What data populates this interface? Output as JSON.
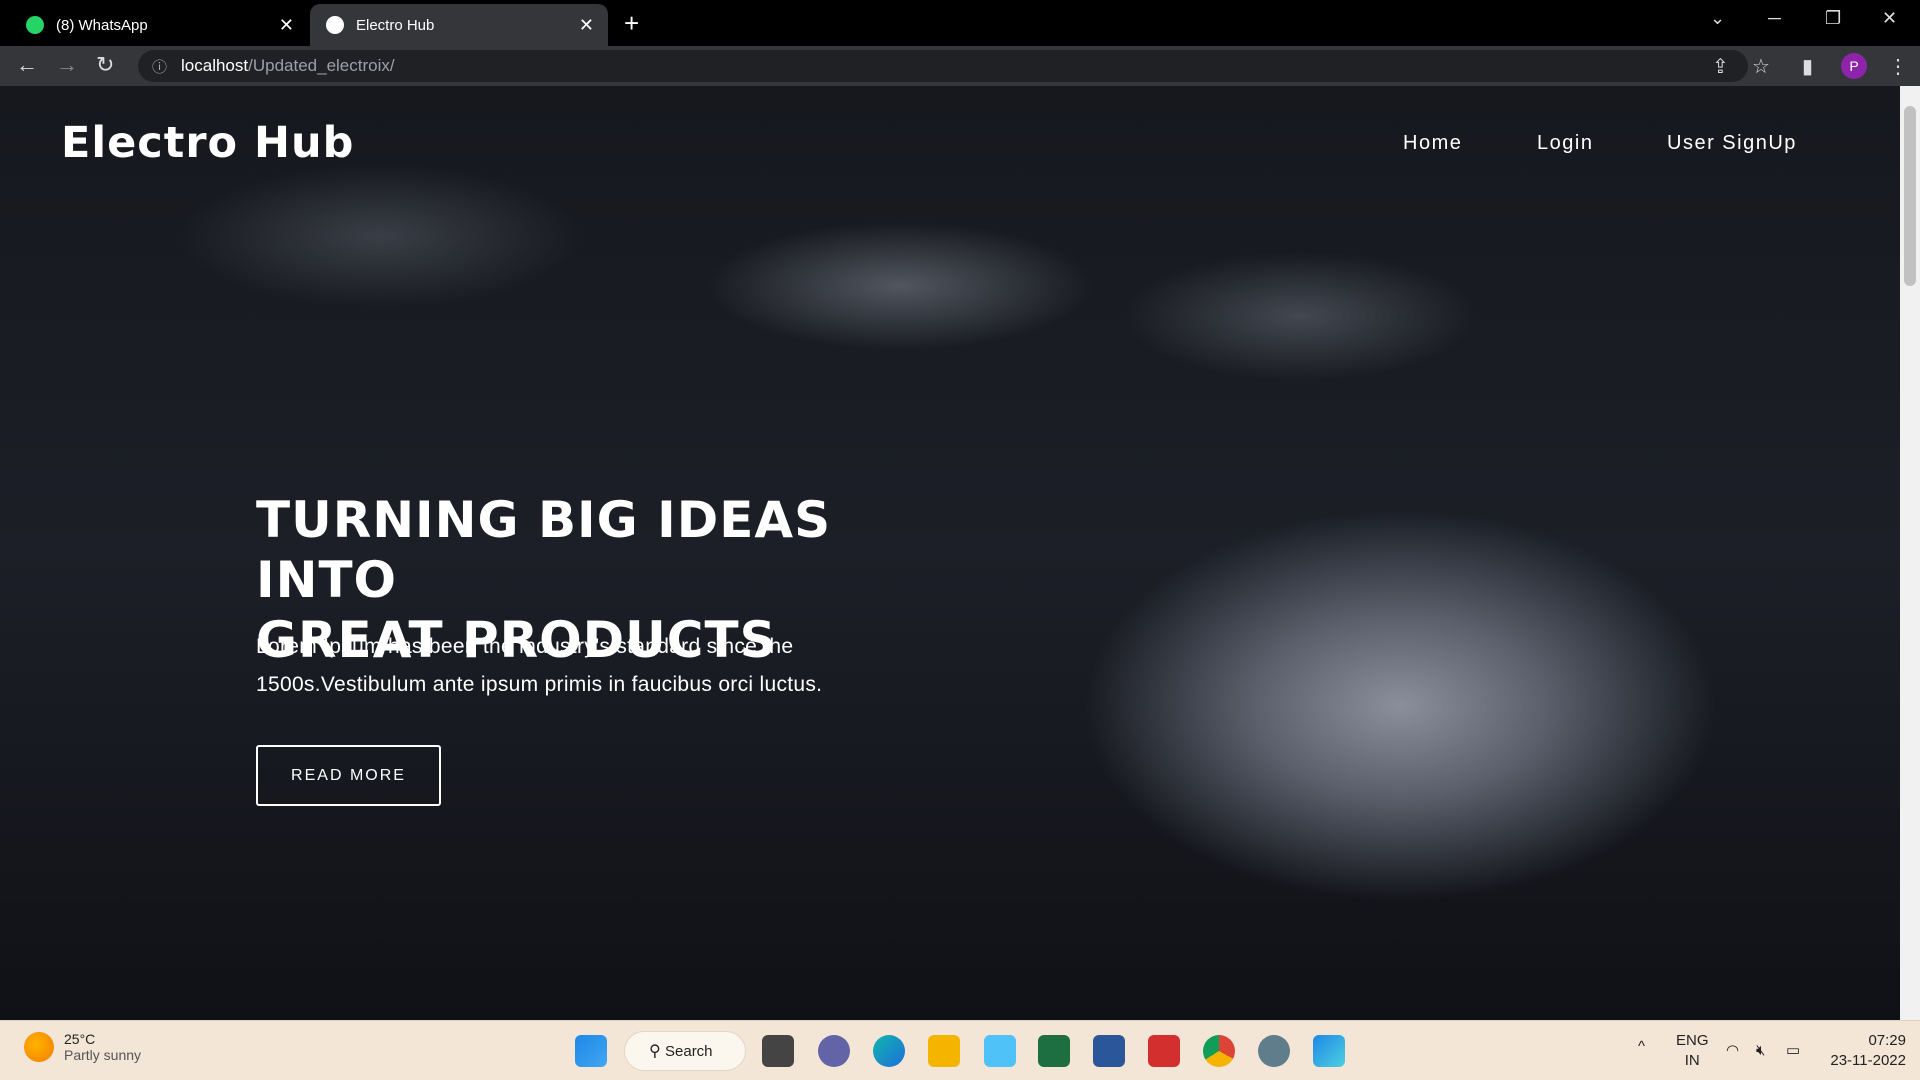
{
  "browser": {
    "tabs": [
      {
        "title": "(8) WhatsApp",
        "badge": "8",
        "active": false
      },
      {
        "title": "Electro Hub",
        "active": true
      }
    ],
    "close_glyph": "✕",
    "new_tab_glyph": "+",
    "url_host": "localhost",
    "url_path": "/Updated_electroix/",
    "profile_initial": "P"
  },
  "site": {
    "logo": "Electro Hub",
    "nav": [
      "Home",
      "Login",
      "User SignUp"
    ],
    "hero_title_line1": "TURNING BIG IDEAS INTO",
    "hero_title_line2": "GREAT PRODUCTS",
    "hero_text_line1": "Lorem Ipsum has been the industry's standard since the",
    "hero_text_line2": "1500s.Vestibulum ante ipsum primis in faucibus orci luctus.",
    "cta": "READ MORE"
  },
  "taskbar": {
    "temp": "25°C",
    "weather": "Partly sunny",
    "search": "Search",
    "lang1": "ENG",
    "lang2": "IN",
    "time": "07:29",
    "date": "23-11-2022"
  },
  "colors": {
    "accent_profile": "#8e24aa",
    "taskbar_bg": "#f3e6d6"
  }
}
